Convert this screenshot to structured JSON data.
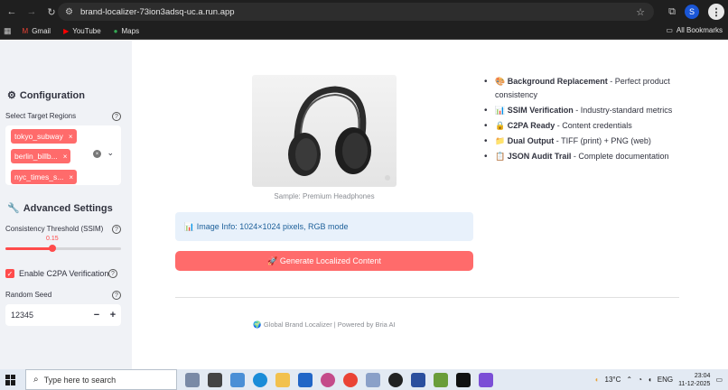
{
  "browser": {
    "url": "brand-localizer-73ion3adsq-uc.a.run.app",
    "profile_initial": "S",
    "bookmarks": [
      {
        "label": "Gmail",
        "icon": "gmail-icon"
      },
      {
        "label": "YouTube",
        "icon": "youtube-icon"
      },
      {
        "label": "Maps",
        "icon": "maps-icon"
      }
    ],
    "all_bookmarks": "All Bookmarks"
  },
  "sidebar": {
    "configuration_title": "Configuration",
    "regions_label": "Select Target Regions",
    "regions": [
      "tokyo_subway",
      "berlin_billb...",
      "nyc_times_s..."
    ],
    "advanced_title": "Advanced Settings",
    "threshold_label": "Consistency Threshold (SSIM)",
    "threshold_value": "0.15",
    "threshold_fraction": 0.15,
    "c2pa_label": "Enable C2PA Verification",
    "c2pa_checked": true,
    "seed_label": "Random Seed",
    "seed_value": "12345",
    "minus": "−",
    "plus": "+"
  },
  "main": {
    "image_caption": "Sample: Premium Headphones",
    "features": [
      {
        "emoji": "🎨",
        "title": "Background Replacement",
        "desc": " - Perfect product consistency"
      },
      {
        "emoji": "📊",
        "title": "SSIM Verification",
        "desc": " - Industry-standard metrics"
      },
      {
        "emoji": "🔒",
        "title": "C2PA Ready",
        "desc": " - Content credentials"
      },
      {
        "emoji": "📁",
        "title": "Dual Output",
        "desc": " - TIFF (print) + PNG (web)"
      },
      {
        "emoji": "📋",
        "title": "JSON Audit Trail",
        "desc": " - Complete documentation"
      }
    ],
    "info_text": "📊 Image Info: 1024×1024 pixels, RGB mode",
    "generate_label": "🚀 Generate Localized Content",
    "footer": "🌍 Global Brand Localizer | Powered by Bria AI"
  },
  "taskbar": {
    "search_placeholder": "Type here to search",
    "temperature": "13°C",
    "language": "ENG",
    "time": "23:04",
    "date": "11-12-2025"
  },
  "colors": {
    "accent": "#ff4b4b",
    "tag": "#ff6b6b",
    "info_bg": "#e8f1fb",
    "sidebar_bg": "#f0f2f6"
  }
}
